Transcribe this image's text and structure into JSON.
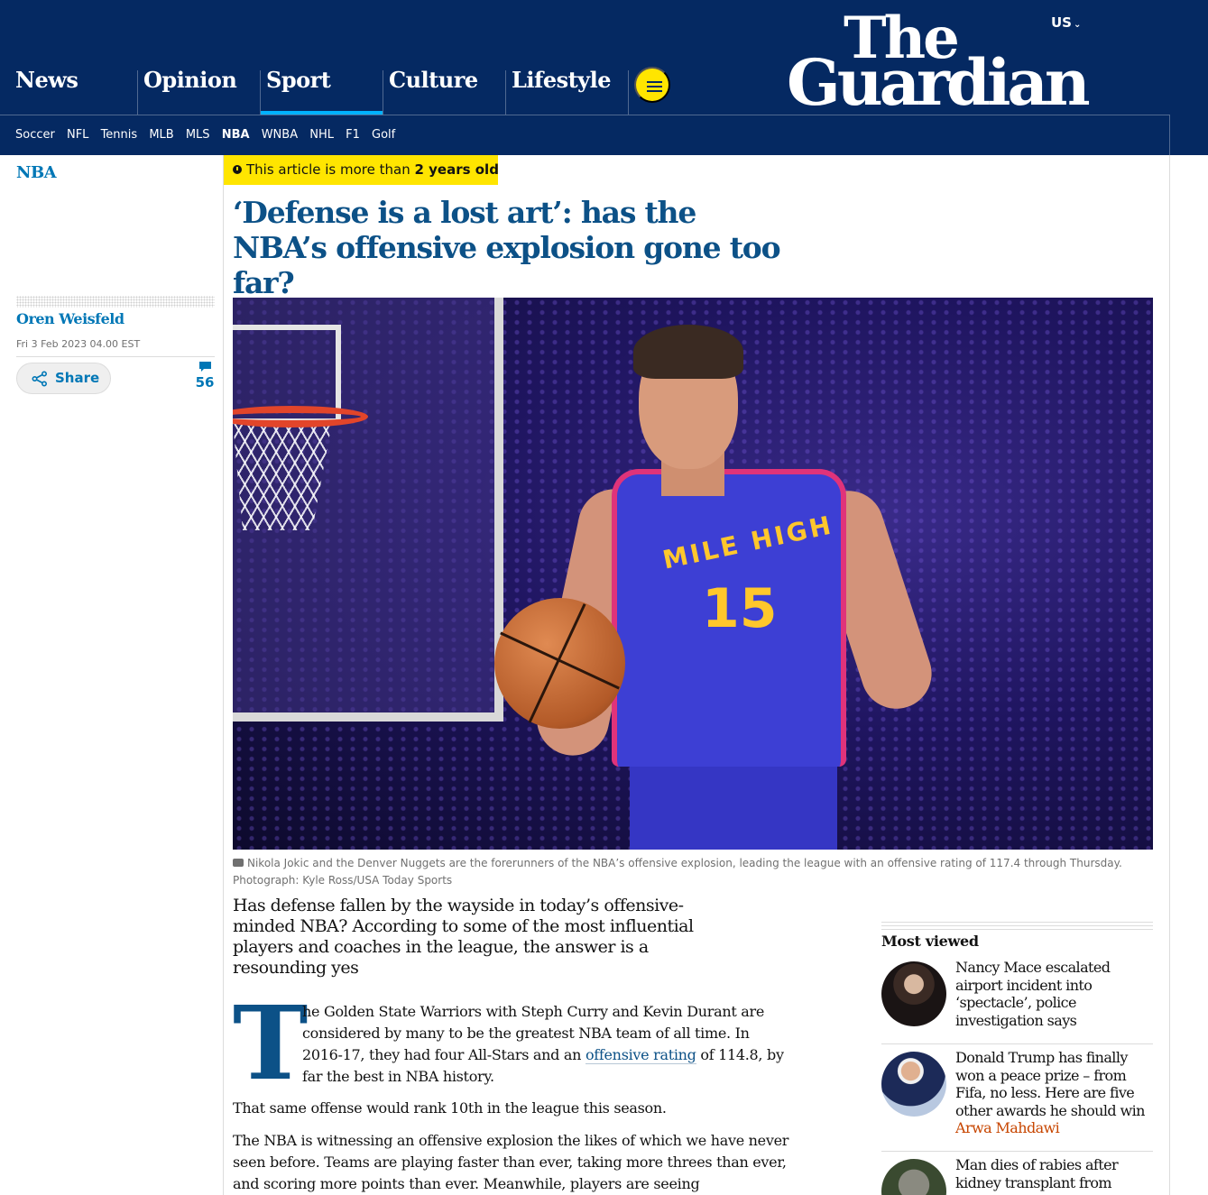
{
  "header": {
    "edition": "US",
    "logo_line1": "The",
    "logo_line2": "Guardian",
    "pillars": [
      {
        "label": "News"
      },
      {
        "label": "Opinion"
      },
      {
        "label": "Sport",
        "active": true
      },
      {
        "label": "Culture"
      },
      {
        "label": "Lifestyle"
      }
    ],
    "subnav": [
      "Soccer",
      "NFL",
      "Tennis",
      "MLB",
      "MLS",
      "NBA",
      "WNBA",
      "NHL",
      "F1",
      "Golf"
    ],
    "subnav_current": "NBA"
  },
  "sidebar": {
    "section": "NBA",
    "author": "Oren Weisfeld",
    "date": "Fri 3 Feb 2023 04.00 EST",
    "share_label": "Share",
    "comment_count": "56"
  },
  "article": {
    "age_prefix": "This article is more than ",
    "age_value": "2 years old",
    "headline": "‘Defense is a lost art’: has the NBA’s offensive explosion gone too far?",
    "caption": "Nikola Jokic and the Denver Nuggets are the forerunners of the NBA’s offensive explosion, leading the league with an offensive rating of 117.4 through Thursday. Photograph: Kyle Ross/USA Today Sports",
    "jersey_text": "MILE HIGH",
    "jersey_number": "15",
    "standfirst": "Has defense fallen by the wayside in today’s offensive-minded NBA? According to some of the most influential players and coaches in the league, the answer is a resounding yes",
    "dropcap": "T",
    "para1_before": "he Golden State Warriors with Steph Curry and Kevin Durant are considered by many to be the greatest NBA team of all time. In 2016-17, they had four All-Stars and an ",
    "para1_link": "offensive rating",
    "para1_after": " of 114.8, by far the best in NBA history.",
    "para2": "That same offense would rank 10th in the league this season.",
    "para3": "The NBA is witnessing an offensive explosion the likes of which we have never seen before. Teams are playing faster than ever, taking more threes than ever, and scoring more points than ever. Meanwhile, players are seeing"
  },
  "most_viewed": {
    "title": "Most viewed",
    "items": [
      {
        "headline": "Nancy Mace escalated airport incident into ‘spectacle’, police investigation says",
        "author": ""
      },
      {
        "headline": "Donald Trump has finally won a peace prize – from Fifa, no less. Here are five other awards he should win",
        "author": "Arwa Mahdawi"
      },
      {
        "headline": "Man dies of rabies after kidney transplant from",
        "author": ""
      }
    ]
  },
  "colors": {
    "brand_navy": "#052962",
    "headline_blue": "#0c5187",
    "link_blue": "#0077b6",
    "highlight_yellow": "#ffe500",
    "opinion_orange": "#c74600"
  }
}
